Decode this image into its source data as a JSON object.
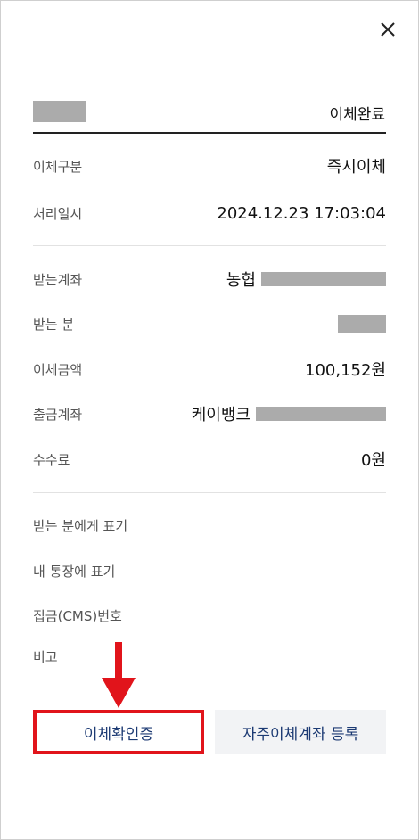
{
  "header": {
    "status": "이체완료"
  },
  "section1": [
    {
      "label": "이체구분",
      "value": "즉시이체"
    },
    {
      "label": "처리일시",
      "value": "2024.12.23 17:03:04"
    }
  ],
  "section2": [
    {
      "label": "받는계좌",
      "bank": "농협"
    },
    {
      "label": "받는 분"
    },
    {
      "label": "이체금액",
      "value": "100,152원"
    },
    {
      "label": "출금계좌",
      "bank": "케이뱅크"
    },
    {
      "label": "수수료",
      "value": "0원"
    }
  ],
  "section3": [
    {
      "label": "받는 분에게 표기"
    },
    {
      "label": "내 통장에 표기"
    },
    {
      "label": "집금(CMS)번호"
    },
    {
      "label": "비고"
    }
  ],
  "buttons": {
    "confirm": "이체확인증",
    "register": "자주이체계좌 등록"
  },
  "colors": {
    "highlight": "#e1141b",
    "button_text": "#1c3a73",
    "mask": "#ababab"
  },
  "icons": {
    "close": "close-icon",
    "arrow": "arrow-down-icon"
  }
}
